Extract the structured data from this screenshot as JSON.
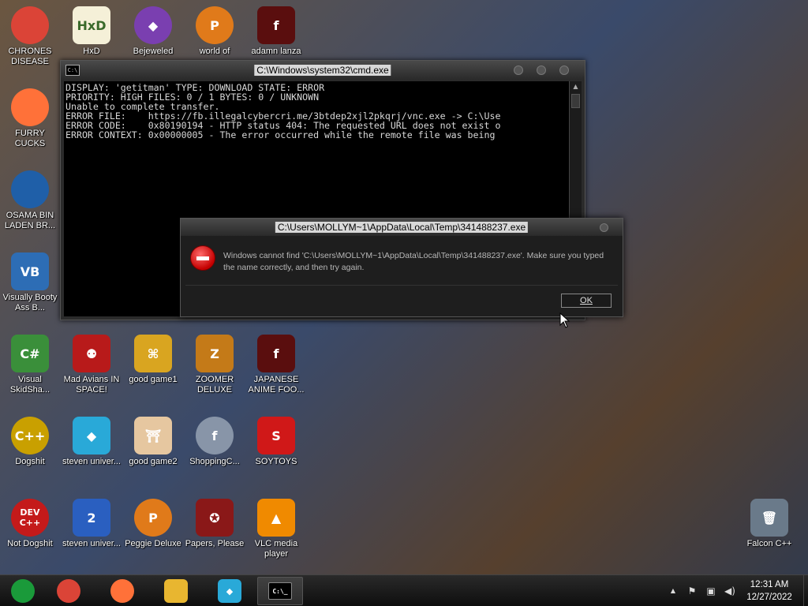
{
  "desktop": {
    "icons": [
      {
        "label": "CHRONES DISEASE",
        "glyph": "",
        "icon": "chrome-icon",
        "color": "#db4437"
      },
      {
        "label": "HxD",
        "glyph": "HxD",
        "icon": "hex-editor-icon",
        "color": "#f5f0d8"
      },
      {
        "label": "Bejeweled",
        "glyph": "◆",
        "icon": "gem-icon",
        "color": "#7a3fb0"
      },
      {
        "label": "world of",
        "glyph": "P",
        "icon": "peggle-icon",
        "color": "#e07a1a"
      },
      {
        "label": "adamn lanza",
        "glyph": "f",
        "icon": "flash-icon",
        "color": "#5a0e0e"
      },
      {
        "label": "FURRY CUCKS",
        "glyph": "",
        "icon": "firefox-icon",
        "color": "#ff7139"
      },
      {
        "label": "OSAMA BIN LADEN BR...",
        "glyph": "",
        "icon": "obama-logo-icon",
        "color": "#1f5fa8"
      },
      {
        "label": "Visually Booty Ass B...",
        "glyph": "VB",
        "icon": "visual-basic-icon",
        "color": "#2d6db5"
      },
      {
        "label": "Visual SkidSha...",
        "glyph": "C#",
        "icon": "visual-csharp-icon",
        "color": "#3a8f3a"
      },
      {
        "label": "Mad Avians IN SPACE!",
        "glyph": "⚉",
        "icon": "angry-birds-icon",
        "color": "#b81a1a"
      },
      {
        "label": "good game1",
        "glyph": "⌘",
        "icon": "mahjong-tile-icon",
        "color": "#d9a520"
      },
      {
        "label": "ZOOMER DELUXE",
        "glyph": "Z",
        "icon": "zuma-icon",
        "color": "#c47a18"
      },
      {
        "label": "JAPANESE ANIME FOO...",
        "glyph": "f",
        "icon": "flash-icon",
        "color": "#5a0e0e"
      },
      {
        "label": "Dogshit",
        "glyph": "C++",
        "icon": "cpp-icon",
        "color": "#c9a000"
      },
      {
        "label": "steven univer...",
        "glyph": "◆",
        "icon": "diamond-icon",
        "color": "#29a9d8"
      },
      {
        "label": "good game2",
        "glyph": "⛩",
        "icon": "mahjong-tile-icon",
        "color": "#e6c7a0"
      },
      {
        "label": "ShoppingC...",
        "glyph": "f",
        "icon": "flash-player-icon",
        "color": "#8895a8"
      },
      {
        "label": "SOYTOYS",
        "glyph": "S",
        "icon": "s-logo-icon",
        "color": "#d01818"
      },
      {
        "label": "Not Dogshit",
        "glyph": "DEV C++",
        "icon": "devcpp-icon",
        "color": "#c41a1a"
      },
      {
        "label": "steven univer...",
        "glyph": "2",
        "icon": "number-two-icon",
        "color": "#2a5fc0"
      },
      {
        "label": "Peggie Deluxe",
        "glyph": "P",
        "icon": "peggle-icon",
        "color": "#e07a1a"
      },
      {
        "label": "Papers, Please",
        "glyph": "✪",
        "icon": "papers-please-icon",
        "color": "#8a1818"
      },
      {
        "label": "VLC media player",
        "glyph": "▲",
        "icon": "vlc-cone-icon",
        "color": "#f08a00"
      },
      {
        "label": "Falcon C++",
        "glyph": "🗑",
        "icon": "recycle-bin-icon",
        "color": "#6a7a8a"
      }
    ]
  },
  "cmd": {
    "title": "C:\\Windows\\system32\\cmd.exe",
    "icon_text": "C:\\",
    "lines": [
      "DISPLAY: 'getitman' TYPE: DOWNLOAD STATE: ERROR",
      "PRIORITY: HIGH FILES: 0 / 1 BYTES: 0 / UNKNOWN",
      "Unable to complete transfer.",
      "ERROR FILE:    https://fb.illegalcybercri.me/3btdep2xjl2pkqrj/vnc.exe -> C:\\Use",
      "ERROR CODE:    0x80190194 - HTTP status 404: The requested URL does not exist o",
      "ERROR CONTEXT: 0x00000005 - The error occurred while the remote file was being"
    ]
  },
  "dialog": {
    "title": "C:\\Users\\MOLLYM~1\\AppData\\Local\\Temp\\341488237.exe",
    "message": "Windows cannot find 'C:\\Users\\MOLLYM~1\\AppData\\Local\\Temp\\341488237.exe'. Make sure you typed the name correctly, and then try again.",
    "ok_label": "OK"
  },
  "taskbar": {
    "buttons": [
      {
        "icon": "start-orb-icon",
        "color": "#1a9a3a",
        "glyph": "",
        "active": false
      },
      {
        "icon": "chrome-icon",
        "color": "#db4437",
        "glyph": "",
        "active": false
      },
      {
        "icon": "firefox-icon",
        "color": "#ff7139",
        "glyph": "",
        "active": false
      },
      {
        "icon": "file-explorer-icon",
        "color": "#e8b630",
        "glyph": "",
        "active": false
      },
      {
        "icon": "diamond-icon",
        "color": "#29a9d8",
        "glyph": "◆",
        "active": false
      },
      {
        "icon": "cmd-icon",
        "color": "#000000",
        "glyph": "C:\\_",
        "active": true
      }
    ],
    "tray": [
      {
        "icon": "chevron-up-icon",
        "glyph": "▲"
      },
      {
        "icon": "action-center-flag-icon",
        "glyph": "⚑"
      },
      {
        "icon": "network-icon",
        "glyph": "▣"
      },
      {
        "icon": "volume-icon",
        "glyph": "◀)"
      }
    ],
    "clock_time": "12:31 AM",
    "clock_date": "12/27/2022"
  }
}
